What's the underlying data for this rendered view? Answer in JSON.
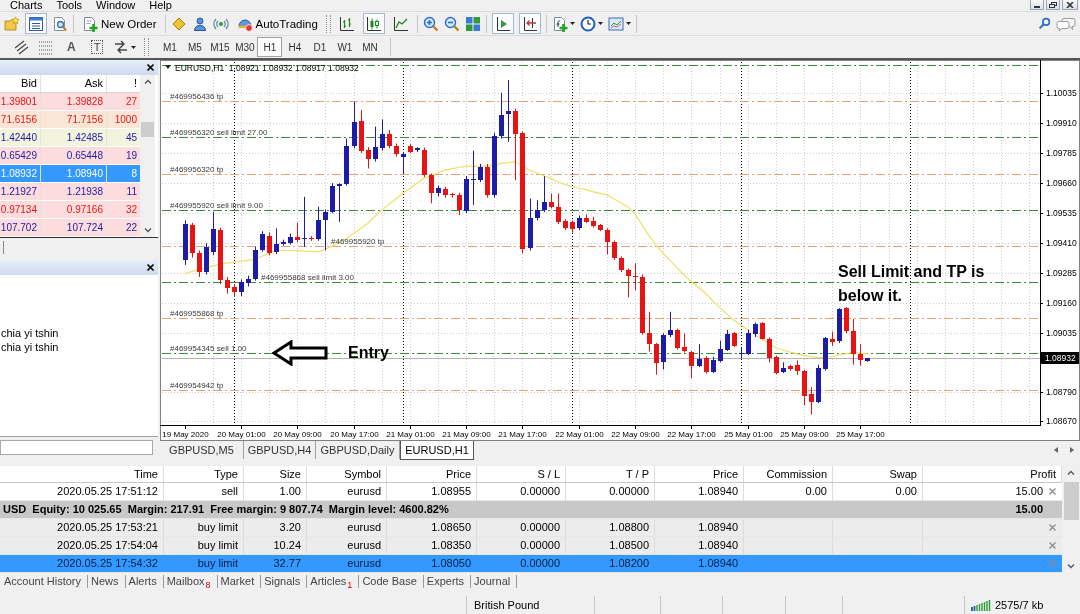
{
  "menu": [
    "Charts",
    "Tools",
    "Window",
    "Help"
  ],
  "toolbar": {
    "market_watch_pressed": true,
    "new_order": "New Order",
    "autotrading": "AutoTrading",
    "chart_types": [
      {
        "selected": false
      },
      {
        "selected": true
      },
      {
        "selected": false
      }
    ],
    "auto_scroll_pressed": true,
    "chart_shift_pressed": true
  },
  "drawing_toolbar": {
    "text_tool": "A",
    "label_tool": "T",
    "timeframes": [
      {
        "label": "M1",
        "selected": false
      },
      {
        "label": "M5",
        "selected": false
      },
      {
        "label": "M15",
        "selected": false
      },
      {
        "label": "M30",
        "selected": false
      },
      {
        "label": "H1",
        "selected": true
      },
      {
        "label": "H4",
        "selected": false
      },
      {
        "label": "D1",
        "selected": false
      },
      {
        "label": "W1",
        "selected": false
      },
      {
        "label": "MN",
        "selected": false
      }
    ]
  },
  "market_watch": {
    "columns": [
      "Bid",
      "Ask",
      "!"
    ],
    "rows": [
      {
        "bid": "1.39801",
        "ask": "1.39828",
        "spread": "27",
        "rising": false,
        "color": "#fcdcdc",
        "selected": false
      },
      {
        "bid": "71.6156",
        "ask": "71.7156",
        "spread": "1000",
        "rising": false,
        "color": "#fbe6d6",
        "selected": false
      },
      {
        "bid": "1.42440",
        "ask": "1.42485",
        "spread": "45",
        "rising": true,
        "color": "#f3f4dc",
        "selected": false
      },
      {
        "bid": "0.65429",
        "ask": "0.65448",
        "spread": "19",
        "rising": true,
        "color": "#fcdcdc",
        "selected": false
      },
      {
        "bid": "1.08932",
        "ask": "1.08940",
        "spread": "8",
        "selected": true
      },
      {
        "bid": "1.21927",
        "ask": "1.21938",
        "spread": "11",
        "rising": true,
        "color": "#fcdcdc",
        "selected": false
      },
      {
        "bid": "0.97134",
        "ask": "0.97166",
        "spread": "32",
        "rising": false,
        "color": "#fcdcdc",
        "selected": false
      },
      {
        "bid": "107.702",
        "ask": "107.724",
        "spread": "22",
        "rising": true,
        "color": "#fcdcdc",
        "selected": false
      }
    ]
  },
  "navigator": {
    "items": [
      "chia yi tshin",
      "chia yi tshin"
    ]
  },
  "chart": {
    "chart_data": [
      {
        "type": "candlestick",
        "title": "EURUSD,H1  1.08921 1.08932 1.08917 1.08932",
        "categories": [
          "19 May 2020",
          null,
          null,
          null,
          null,
          null,
          null,
          null,
          "20 May 01:00",
          null,
          null,
          null,
          null,
          null,
          null,
          null,
          "20 May 09:00",
          null,
          null,
          null,
          null,
          null,
          null,
          null,
          "20 May 17:00",
          null,
          null,
          null,
          null,
          null,
          null,
          null,
          "21 May 01:00",
          null,
          null,
          null,
          null,
          null,
          null,
          null,
          "21 May 09:00",
          null,
          null,
          null,
          null,
          null,
          null,
          null,
          "21 May 17:00",
          null,
          null,
          null,
          null,
          null,
          null,
          null,
          "22 May 01:00",
          null,
          null,
          null,
          null,
          null,
          null,
          null,
          "22 May 09:00",
          null,
          null,
          null,
          null,
          null,
          null,
          null,
          "22 May 17:00",
          null,
          null,
          null,
          null,
          null,
          null,
          null,
          "25 May 01:00",
          null,
          null,
          null,
          null,
          null,
          null,
          null,
          "25 May 09:00",
          null,
          null,
          null,
          null,
          null,
          null,
          null,
          "25 May 17:00",
          null
        ],
        "series": [
          {
            "type": "candlestick",
            "colors": [
              "#1c1ca8",
              "#e61414",
              "#e61414",
              "#1c1ca8",
              "#1c1ca8",
              "#e61414",
              "#e61414",
              "#e61414",
              "#1c1ca8",
              "#1c1ca8",
              "#1c1ca8",
              "#1c1ca8",
              "#e61414",
              "#1c1ca8",
              "#1c1ca8",
              "#1c1ca8",
              "#e61414",
              "#1c1ca8",
              "#e61414",
              "#1c1ca8",
              "#1c1ca8",
              "#1c1ca8",
              "#1c1ca8",
              "#1c1ca8",
              "#1c1ca8",
              "#e61414",
              "#e61414",
              "#1c1ca8",
              "#1c1ca8",
              "#e61414",
              "#e61414",
              "#1c1ca8",
              "#e61414",
              "#1c1ca8",
              "#e61414",
              "#e61414",
              "#1c1ca8",
              "#e61414",
              "#e61414",
              "#e61414",
              "#1c1ca8",
              "#1c1ca8",
              "#1c1ca8",
              "#e61414",
              "#1c1ca8",
              "#1c1ca8",
              "#1c1ca8",
              "#e61414",
              "#e61414",
              "#1c1ca8",
              "#1c1ca8",
              "#1c1ca8",
              "#e61414",
              "#e61414",
              "#e61414",
              "#e61414",
              "#1c1ca8",
              "#e61414",
              "#e61414",
              "#e61414",
              "#e61414",
              "#e61414",
              "#e61414",
              "#e61414",
              "#e61414",
              "#e61414",
              "#e61414",
              "#e61414",
              "#1c1ca8",
              "#1c1ca8",
              "#e61414",
              "#e61414",
              "#e61414",
              "#1c1ca8",
              "#e61414",
              "#1c1ca8",
              "#1c1ca8",
              "#1c1ca8",
              "#e61414",
              "#1c1ca8",
              "#1c1ca8",
              "#1c1ca8",
              "#e61414",
              "#e61414",
              "#e61414",
              "#1c1ca8",
              "#e61414",
              "#e61414",
              "#e61414",
              "#e61414",
              "#1c1ca8",
              "#1c1ca8",
              "#e61414",
              "#1c1ca8",
              "#e61414",
              "#e61414",
              "#e61414",
              "#1c1ca8"
            ],
            "ohlc": [
              [
                1.0934,
                1.09505,
                1.0932,
                1.09492
              ],
              [
                1.09485,
                1.09495,
                1.0935,
                1.09368
              ],
              [
                1.09368,
                1.0938,
                1.0927,
                1.09291
              ],
              [
                1.09291,
                1.0941,
                1.0928,
                1.09395
              ],
              [
                1.09374,
                1.09541,
                1.0936,
                1.09468
              ],
              [
                1.09465,
                1.09475,
                1.0924,
                1.09257
              ],
              [
                1.09257,
                1.0927,
                1.092,
                1.09222
              ],
              [
                1.09229,
                1.0924,
                1.09187,
                1.09208
              ],
              [
                1.09208,
                1.0926,
                1.0919,
                1.0925
              ],
              [
                1.09243,
                1.09275,
                1.0923,
                1.09263
              ],
              [
                1.09263,
                1.09395,
                1.09255,
                1.09384
              ],
              [
                1.09384,
                1.0946,
                1.09375,
                1.09447
              ],
              [
                1.0944,
                1.09455,
                1.0936,
                1.0937
              ],
              [
                1.09374,
                1.09472,
                1.09365,
                1.09406
              ],
              [
                1.09409,
                1.09425,
                1.094,
                1.09416
              ],
              [
                1.09412,
                1.0945,
                1.09405,
                1.09437
              ],
              [
                1.09437,
                1.09495,
                1.09415,
                1.09423
              ],
              [
                1.09426,
                1.09603,
                1.09395,
                1.0943
              ],
              [
                1.09433,
                1.0944,
                1.0942,
                1.09426
              ],
              [
                1.09426,
                1.09562,
                1.0942,
                1.09506
              ],
              [
                1.09506,
                1.0955,
                1.09381,
                1.09541
              ],
              [
                1.09541,
                1.0966,
                1.09535,
                1.09648
              ],
              [
                1.0965,
                1.0966,
                1.09499,
                1.09656
              ],
              [
                1.09656,
                1.09846,
                1.0965,
                1.09814
              ],
              [
                1.09814,
                1.09999,
                1.09805,
                1.09914
              ],
              [
                1.09918,
                1.09964,
                1.09785,
                1.09795
              ],
              [
                1.098,
                1.0981,
                1.09721,
                1.09759
              ],
              [
                1.09761,
                1.09895,
                1.0975,
                1.09809
              ],
              [
                1.09806,
                1.09925,
                1.09795,
                1.09864
              ],
              [
                1.09864,
                1.09881,
                1.09805,
                1.09814
              ],
              [
                1.09814,
                1.09825,
                1.0977,
                1.09781
              ],
              [
                1.09767,
                1.0979,
                1.097,
                1.09781
              ],
              [
                1.09814,
                1.09822,
                1.09785,
                1.09791
              ],
              [
                1.09797,
                1.0981,
                1.0979,
                1.09806
              ],
              [
                1.098,
                1.09808,
                1.09685,
                1.09694
              ],
              [
                1.09694,
                1.097,
                1.09576,
                1.09617
              ],
              [
                1.09617,
                1.0965,
                1.09605,
                1.09641
              ],
              [
                1.09635,
                1.09645,
                1.096,
                1.0961
              ],
              [
                1.09613,
                1.0962,
                1.096,
                1.09609
              ],
              [
                1.0961,
                1.0962,
                1.09527,
                1.09548
              ],
              [
                1.09545,
                1.0969,
                1.09535,
                1.09677
              ],
              [
                1.09673,
                1.09795,
                1.09569,
                1.09678
              ],
              [
                1.09675,
                1.0974,
                1.09665,
                1.09728
              ],
              [
                1.09728,
                1.0974,
                1.096,
                1.0961
              ],
              [
                1.0961,
                1.0987,
                1.096,
                1.09856
              ],
              [
                1.09856,
                1.10036,
                1.09845,
                1.09943
              ],
              [
                1.09946,
                1.10089,
                1.09832,
                1.0996
              ],
              [
                1.0996,
                1.0997,
                1.09673,
                1.09864
              ],
              [
                1.09867,
                1.09875,
                1.09368,
                1.09388
              ],
              [
                1.09391,
                1.09596,
                1.0938,
                1.09517
              ],
              [
                1.09513,
                1.09589,
                1.09505,
                1.09548
              ],
              [
                1.09548,
                1.09689,
                1.0954,
                1.09583
              ],
              [
                1.09583,
                1.09617,
                1.09555,
                1.09562
              ],
              [
                1.09562,
                1.09617,
                1.0949,
                1.09499
              ],
              [
                1.09502,
                1.0951,
                1.09465,
                1.09472
              ],
              [
                1.09499,
                1.09505,
                1.09454,
                1.09469
              ],
              [
                1.09472,
                1.09525,
                1.09465,
                1.09514
              ],
              [
                1.09517,
                1.0953,
                1.09494,
                1.09499
              ],
              [
                1.09502,
                1.0952,
                1.09475,
                1.09481
              ],
              [
                1.09484,
                1.0949,
                1.0946,
                1.09466
              ],
              [
                1.09466,
                1.09472,
                1.09364,
                1.09417
              ],
              [
                1.09417,
                1.09422,
                1.0934,
                1.09349
              ],
              [
                1.09349,
                1.09355,
                1.0929,
                1.09297
              ],
              [
                1.09297,
                1.09305,
                1.09185,
                1.09274
              ],
              [
                1.09274,
                1.09327,
                1.09215,
                1.09271
              ],
              [
                1.09271,
                1.0928,
                1.0903,
                1.09038
              ],
              [
                1.09038,
                1.09125,
                1.0896,
                1.0899
              ],
              [
                1.0899,
                1.08995,
                1.08863,
                1.08912
              ],
              [
                1.08915,
                1.09035,
                1.08885,
                1.09028
              ],
              [
                1.09028,
                1.09125,
                1.0902,
                1.0905
              ],
              [
                1.0905,
                1.09055,
                1.08968,
                1.08975
              ],
              [
                1.08978,
                1.09035,
                1.08955,
                1.0896
              ],
              [
                1.08957,
                1.08962,
                1.08848,
                1.089
              ],
              [
                1.089,
                1.0899,
                1.08895,
                1.0893
              ],
              [
                1.08933,
                1.0894,
                1.08868,
                1.08875
              ],
              [
                1.08875,
                1.08938,
                1.0887,
                1.08923
              ],
              [
                1.0892,
                1.09005,
                1.08915,
                1.08971
              ],
              [
                1.08968,
                1.0905,
                1.08962,
                1.09032
              ],
              [
                1.09035,
                1.0904,
                1.08978,
                1.08983
              ],
              [
                1.08948,
                1.08975,
                1.0893,
                1.08953
              ],
              [
                1.0895,
                1.0905,
                1.08945,
                1.09038
              ],
              [
                1.09032,
                1.0908,
                1.0902,
                1.09075
              ],
              [
                1.09077,
                1.09082,
                1.0901,
                1.09013
              ],
              [
                1.09013,
                1.09018,
                1.08915,
                1.08933
              ],
              [
                1.08938,
                1.08943,
                1.08865,
                1.0887
              ],
              [
                1.08875,
                1.08915,
                1.0887,
                1.08893
              ],
              [
                1.089,
                1.08905,
                1.0888,
                1.08885
              ],
              [
                1.08903,
                1.08923,
                1.08863,
                1.08878
              ],
              [
                1.08878,
                1.08883,
                1.08736,
                1.08776
              ],
              [
                1.08781,
                1.08811,
                1.08698,
                1.08751
              ],
              [
                1.08751,
                1.08905,
                1.08745,
                1.0889
              ],
              [
                1.08885,
                1.0902,
                1.0888,
                1.09017
              ],
              [
                1.09013,
                1.09043,
                1.08983,
                1.09001
              ],
              [
                1.09002,
                1.0914,
                1.08995,
                1.09135
              ],
              [
                1.0914,
                1.09145,
                1.09036,
                1.09043
              ],
              [
                1.09043,
                1.09095,
                1.08905,
                1.08948
              ],
              [
                1.08948,
                1.0899,
                1.089,
                1.08926
              ],
              [
                1.08921,
                1.08932,
                1.08917,
                1.08932
              ]
            ]
          },
          {
            "type": "line",
            "color": "#efe06a",
            "values": [
              1.09284,
              1.09292,
              1.093,
              1.09307,
              1.09315,
              1.09323,
              1.09327,
              1.09331,
              1.09335,
              1.09339,
              1.09343,
              1.09356,
              1.09368,
              1.09381,
              1.0938,
              1.0938,
              1.09379,
              1.09377,
              1.09376,
              1.09374,
              1.09384,
              1.09399,
              1.09415,
              1.0943,
              1.09451,
              1.09471,
              1.09492,
              1.0952,
              1.09548,
              1.09571,
              1.09594,
              1.09617,
              1.09638,
              1.09659,
              1.0968,
              1.09691,
              1.09703,
              1.09714,
              1.0972,
              1.09725,
              1.09731,
              1.09731,
              1.09731,
              1.09731,
              1.09737,
              1.09742,
              1.09746,
              1.09749,
              1.09732,
              1.09714,
              1.09703,
              1.09691,
              1.0968,
              1.09665,
              1.09655,
              1.09646,
              1.0964,
              1.09633,
              1.09625,
              1.09618,
              1.09611,
              1.09594,
              1.09578,
              1.09561,
              1.0953,
              1.09485,
              1.09441,
              1.094,
              1.09368,
              1.09337,
              1.09306,
              1.09276,
              1.0925,
              1.09226,
              1.09202,
              1.0917,
              1.09143,
              1.09116,
              1.0909,
              1.0907,
              1.0905,
              1.0903,
              1.09011,
              1.08993,
              1.08975,
              1.08966,
              1.08957,
              1.0895,
              1.08944,
              1.08938,
              1.08935,
              1.08933,
              1.08939,
              1.08946,
              1.08951,
              1.08956,
              1.08953,
              1.0895
            ]
          }
        ],
        "ylim": [
          1.08654,
          1.10164
        ],
        "yticks": [
          {
            "value": 1.10035,
            "label": "1.10035"
          },
          {
            "value": 1.0991,
            "label": "1.09910"
          },
          {
            "value": 1.09785,
            "label": "1.09785"
          },
          {
            "value": 1.0966,
            "label": "1.09660"
          },
          {
            "value": 1.09535,
            "label": "1.09535"
          },
          {
            "value": 1.0941,
            "label": "1.09410"
          },
          {
            "value": 1.09285,
            "label": "1.09285"
          },
          {
            "value": 1.0916,
            "label": "1.09160"
          },
          {
            "value": 1.09035,
            "label": "1.09035"
          },
          {
            "value": 1.0879,
            "label": "1.08790"
          },
          {
            "value": 1.0867,
            "label": "1.08670"
          }
        ],
        "grid": true,
        "ref_lines": [
          {
            "axis": "y",
            "value": 1.1015,
            "color": "#3a8a3a",
            "line_style": "dash-dot"
          },
          {
            "axis": "y",
            "value": 1.1,
            "label": "#469956436 tp",
            "color": "#e8a07a",
            "line_style": "dash-dot"
          },
          {
            "axis": "y",
            "value": 1.0985,
            "label": "#469956320 sell limit 27.00",
            "color": "#3a8a3a",
            "line_style": "dash-dot"
          },
          {
            "axis": "y",
            "value": 1.097,
            "label": "#469956320 tp",
            "color": "#e8a07a",
            "line_style": "dash-dot"
          },
          {
            "axis": "y",
            "value": 1.0955,
            "label": "#469955920 sell limit 9.00",
            "color": "#3a8a3a",
            "line_style": "dash-dot"
          },
          {
            "axis": "y",
            "value": 1.094,
            "label": "#469955920 tp",
            "color": "#e8a07a",
            "line_style": "dash-dot"
          },
          {
            "axis": "y",
            "value": 1.0925,
            "label": "#469955868 sell limit 3.00",
            "color": "#3a8a3a",
            "line_style": "dash-dot"
          },
          {
            "axis": "y",
            "value": 1.091,
            "label": "#469955868 tp",
            "color": "#e8a07a",
            "line_style": "dash-dot"
          },
          {
            "axis": "y",
            "value": 1.08955,
            "label": "#469954345 sell 1.00",
            "color": "#3a8a3a",
            "line_style": "dash-dot"
          },
          {
            "axis": "y",
            "value": 1.088,
            "label": "#469954942 tp",
            "color": "#e8a07a",
            "line_style": "dash-dot"
          },
          {
            "axis": "y",
            "value": 1.08932,
            "label": "1.08932",
            "color": "#b4b4b4",
            "line_style": "solid"
          }
        ],
        "annotations": [
          "Entry",
          "Sell Limit and TP is below it."
        ]
      }
    ]
  },
  "chart_tabs": [
    {
      "label": "GBPUSD,M5",
      "selected": false
    },
    {
      "label": "GBPUSD,H4",
      "selected": false
    },
    {
      "label": "GBPUSD,Daily",
      "selected": false
    },
    {
      "label": "EURUSD,H1",
      "selected": true
    }
  ],
  "terminal": {
    "columns": [
      "Time",
      "Type",
      "Size",
      "Symbol",
      "Price",
      "S / L",
      "T / P",
      "Price",
      "Commission",
      "Swap",
      "Profit"
    ],
    "rows": [
      {
        "kind": "trade",
        "selected": false,
        "cells": [
          "2020.05.25 17:51:12",
          "sell",
          "1.00",
          "eurusd",
          "1.08955",
          "0.00000",
          "0.00000",
          "1.08940",
          "0.00",
          "0.00",
          "15.00"
        ]
      },
      {
        "kind": "summary",
        "selected": false,
        "text": "USD  Equity: 10 025.65  Margin: 217.91  Free margin: 9 807.74  Margin level: 4600.82%",
        "profit": "15.00"
      },
      {
        "kind": "order",
        "selected": false,
        "cells": [
          "2020.05.25 17:53:21",
          "buy limit",
          "3.20",
          "eurusd",
          "1.08650",
          "0.00000",
          "1.08800",
          "1.08940"
        ]
      },
      {
        "kind": "order",
        "selected": false,
        "cells": [
          "2020.05.25 17:54:04",
          "buy limit",
          "10.24",
          "eurusd",
          "1.08350",
          "0.00000",
          "1.08500",
          "1.08940"
        ]
      },
      {
        "kind": "order",
        "selected": true,
        "cells": [
          "2020.05.25 17:54:32",
          "buy limit",
          "32.77",
          "eurusd",
          "1.08050",
          "0.00000",
          "1.08200",
          "1.08940"
        ]
      }
    ]
  },
  "terminal_tabs": [
    {
      "label": "Account History",
      "selected": false
    },
    {
      "label": "News",
      "selected": false
    },
    {
      "label": "Alerts",
      "selected": false
    },
    {
      "label": "Mailbox",
      "badge": "8",
      "selected": false
    },
    {
      "label": "Market",
      "selected": false
    },
    {
      "label": "Signals",
      "selected": false
    },
    {
      "label": "Articles",
      "badge": "1",
      "selected": false
    },
    {
      "label": "Code Base",
      "selected": false
    },
    {
      "label": "Experts",
      "selected": false
    },
    {
      "label": "Journal",
      "selected": false
    }
  ],
  "status_bar": {
    "symbol": "British Pound",
    "traffic": "2575/7 kb"
  }
}
